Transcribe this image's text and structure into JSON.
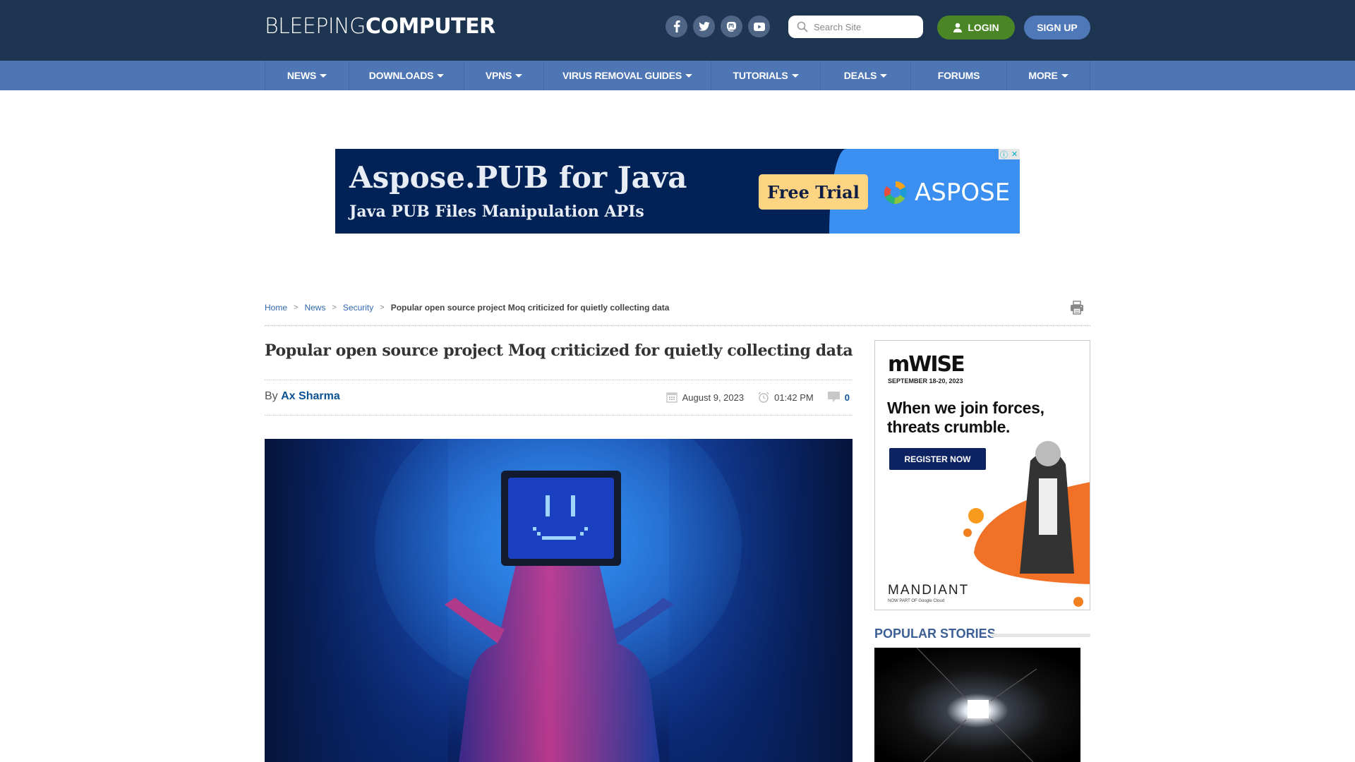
{
  "header": {
    "logo_light": "BLEEPING",
    "logo_bold": "COMPUTER",
    "social": [
      {
        "name": "facebook-icon",
        "glyph": "f"
      },
      {
        "name": "twitter-icon",
        "glyph": "t"
      },
      {
        "name": "mastodon-icon",
        "glyph": "m"
      },
      {
        "name": "youtube-icon",
        "glyph": "y"
      }
    ],
    "search_placeholder": "Search Site",
    "login_label": "LOGIN",
    "signup_label": "SIGN UP"
  },
  "nav": {
    "items": [
      {
        "label": "NEWS",
        "dropdown": true
      },
      {
        "label": "DOWNLOADS",
        "dropdown": true
      },
      {
        "label": "VPNS",
        "dropdown": true
      },
      {
        "label": "VIRUS REMOVAL GUIDES",
        "dropdown": true
      },
      {
        "label": "TUTORIALS",
        "dropdown": true
      },
      {
        "label": "DEALS",
        "dropdown": true
      },
      {
        "label": "FORUMS",
        "dropdown": false
      },
      {
        "label": "MORE",
        "dropdown": true
      }
    ]
  },
  "top_ad": {
    "headline": "Aspose.PUB for Java",
    "subheadline": "Java PUB Files Manipulation APIs",
    "cta": "Free Trial",
    "brand": "ASPOSE",
    "colors": {
      "dark": "#012256",
      "blue": "#3a8ff0",
      "cta": "#fdd482"
    }
  },
  "breadcrumb": {
    "items": [
      "Home",
      "News",
      "Security"
    ],
    "current": "Popular open source project Moq criticized for quietly collecting data"
  },
  "article": {
    "title": "Popular open source project Moq criticized for quietly collecting data",
    "by_label": "By",
    "author": "Ax Sharma",
    "date": "August 9, 2023",
    "time": "01:42 PM",
    "comments": "0"
  },
  "side_ad": {
    "brand": "mWISE",
    "dates": "SEPTEMBER 18-20, 2023",
    "headline_1": "When we join forces,",
    "headline_2": "threats crumble.",
    "cta": "REGISTER NOW",
    "sponsor": "MANDIANT",
    "sponsor_sub": "NOW PART OF Google Cloud"
  },
  "sidebar": {
    "popular_title": "POPULAR STORIES"
  },
  "colors": {
    "header_bg": "#1e3552",
    "nav_bg": "#4e76b4",
    "login": "#4a8526",
    "signup": "#4e78b8",
    "link": "#3068b0",
    "author": "#0b5394"
  }
}
